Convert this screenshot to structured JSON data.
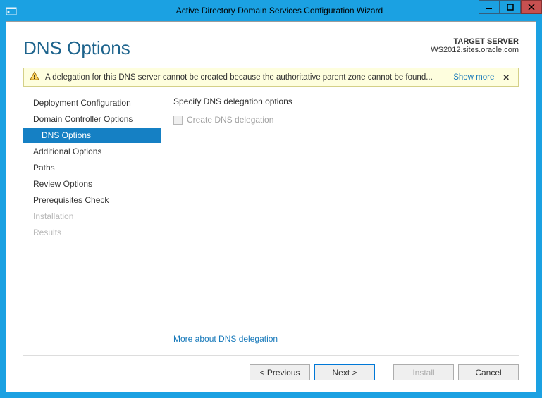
{
  "window": {
    "title": "Active Directory Domain Services Configuration Wizard"
  },
  "header": {
    "title": "DNS Options",
    "target_label": "TARGET SERVER",
    "target_value": "WS2012.sites.oracle.com"
  },
  "warning": {
    "text": "A delegation for this DNS server cannot be created because the authoritative parent zone cannot be found...",
    "show_more": "Show more"
  },
  "sidebar": {
    "items": [
      {
        "label": "Deployment Configuration",
        "state": "normal"
      },
      {
        "label": "Domain Controller Options",
        "state": "normal"
      },
      {
        "label": "DNS Options",
        "state": "selected"
      },
      {
        "label": "Additional Options",
        "state": "normal"
      },
      {
        "label": "Paths",
        "state": "normal"
      },
      {
        "label": "Review Options",
        "state": "normal"
      },
      {
        "label": "Prerequisites Check",
        "state": "normal"
      },
      {
        "label": "Installation",
        "state": "disabled"
      },
      {
        "label": "Results",
        "state": "disabled"
      }
    ]
  },
  "main": {
    "heading": "Specify DNS delegation options",
    "checkbox_label": "Create DNS delegation",
    "checkbox_checked": false,
    "more_link": "More about DNS delegation"
  },
  "footer": {
    "previous": "< Previous",
    "next": "Next >",
    "install": "Install",
    "cancel": "Cancel"
  }
}
